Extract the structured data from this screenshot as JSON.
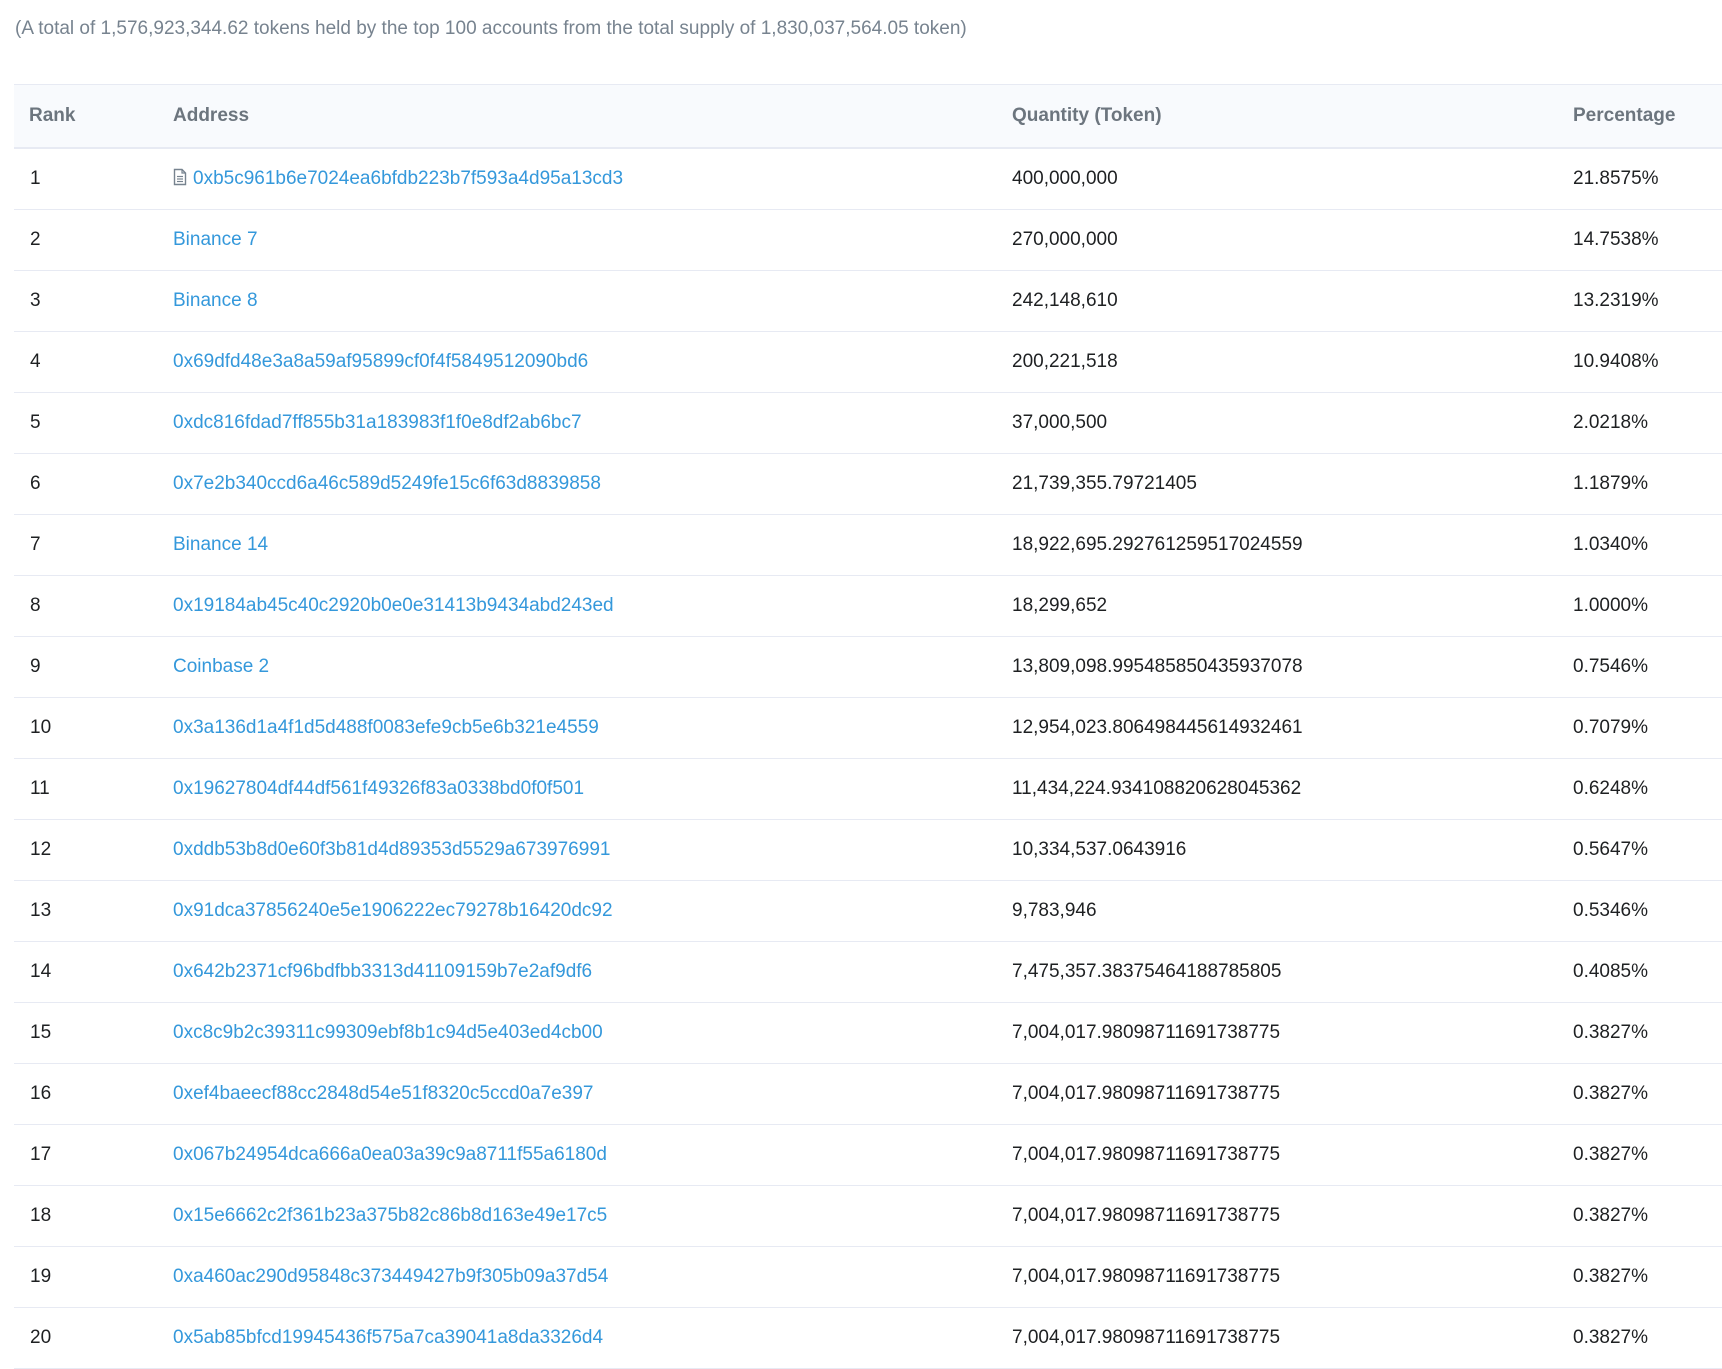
{
  "summary_text": "(A total of 1,576,923,344.62 tokens held by the top 100 accounts from the total supply of 1,830,037,564.05 token)",
  "table": {
    "headers": {
      "rank": "Rank",
      "address": "Address",
      "quantity": "Quantity (Token)",
      "percentage": "Percentage"
    },
    "link_color": "#3498db",
    "rows": [
      {
        "rank": "1",
        "address": "0xb5c961b6e7024ea6bfdb223b7f593a4d95a13cd3",
        "is_contract": true,
        "icon": "contract-file-icon",
        "quantity": "400,000,000",
        "percentage": "21.8575%"
      },
      {
        "rank": "2",
        "address": "Binance 7",
        "is_contract": false,
        "quantity": "270,000,000",
        "percentage": "14.7538%"
      },
      {
        "rank": "3",
        "address": "Binance 8",
        "is_contract": false,
        "quantity": "242,148,610",
        "percentage": "13.2319%"
      },
      {
        "rank": "4",
        "address": "0x69dfd48e3a8a59af95899cf0f4f5849512090bd6",
        "is_contract": false,
        "quantity": "200,221,518",
        "percentage": "10.9408%"
      },
      {
        "rank": "5",
        "address": "0xdc816fdad7ff855b31a183983f1f0e8df2ab6bc7",
        "is_contract": false,
        "quantity": "37,000,500",
        "percentage": "2.0218%"
      },
      {
        "rank": "6",
        "address": "0x7e2b340ccd6a46c589d5249fe15c6f63d8839858",
        "is_contract": false,
        "quantity": "21,739,355.79721405",
        "percentage": "1.1879%"
      },
      {
        "rank": "7",
        "address": "Binance 14",
        "is_contract": false,
        "quantity": "18,922,695.292761259517024559",
        "percentage": "1.0340%"
      },
      {
        "rank": "8",
        "address": "0x19184ab45c40c2920b0e0e31413b9434abd243ed",
        "is_contract": false,
        "quantity": "18,299,652",
        "percentage": "1.0000%"
      },
      {
        "rank": "9",
        "address": "Coinbase 2",
        "is_contract": false,
        "quantity": "13,809,098.995485850435937078",
        "percentage": "0.7546%"
      },
      {
        "rank": "10",
        "address": "0x3a136d1a4f1d5d488f0083efe9cb5e6b321e4559",
        "is_contract": false,
        "quantity": "12,954,023.806498445614932461",
        "percentage": "0.7079%"
      },
      {
        "rank": "11",
        "address": "0x19627804df44df561f49326f83a0338bd0f0f501",
        "is_contract": false,
        "quantity": "11,434,224.934108820628045362",
        "percentage": "0.6248%"
      },
      {
        "rank": "12",
        "address": "0xddb53b8d0e60f3b81d4d89353d5529a673976991",
        "is_contract": false,
        "quantity": "10,334,537.0643916",
        "percentage": "0.5647%"
      },
      {
        "rank": "13",
        "address": "0x91dca37856240e5e1906222ec79278b16420dc92",
        "is_contract": false,
        "quantity": "9,783,946",
        "percentage": "0.5346%"
      },
      {
        "rank": "14",
        "address": "0x642b2371cf96bdfbb3313d41109159b7e2af9df6",
        "is_contract": false,
        "quantity": "7,475,357.38375464188785805",
        "percentage": "0.4085%"
      },
      {
        "rank": "15",
        "address": "0xc8c9b2c39311c99309ebf8b1c94d5e403ed4cb00",
        "is_contract": false,
        "quantity": "7,004,017.98098711691738775",
        "percentage": "0.3827%"
      },
      {
        "rank": "16",
        "address": "0xef4baeecf88cc2848d54e51f8320c5ccd0a7e397",
        "is_contract": false,
        "quantity": "7,004,017.98098711691738775",
        "percentage": "0.3827%"
      },
      {
        "rank": "17",
        "address": "0x067b24954dca666a0ea03a39c9a8711f55a6180d",
        "is_contract": false,
        "quantity": "7,004,017.98098711691738775",
        "percentage": "0.3827%"
      },
      {
        "rank": "18",
        "address": "0x15e6662c2f361b23a375b82c86b8d163e49e17c5",
        "is_contract": false,
        "quantity": "7,004,017.98098711691738775",
        "percentage": "0.3827%"
      },
      {
        "rank": "19",
        "address": "0xa460ac290d95848c373449427b9f305b09a37d54",
        "is_contract": false,
        "quantity": "7,004,017.98098711691738775",
        "percentage": "0.3827%"
      },
      {
        "rank": "20",
        "address": "0x5ab85bfcd19945436f575a7ca39041a8da3326d4",
        "is_contract": false,
        "quantity": "7,004,017.98098711691738775",
        "percentage": "0.3827%"
      }
    ]
  }
}
